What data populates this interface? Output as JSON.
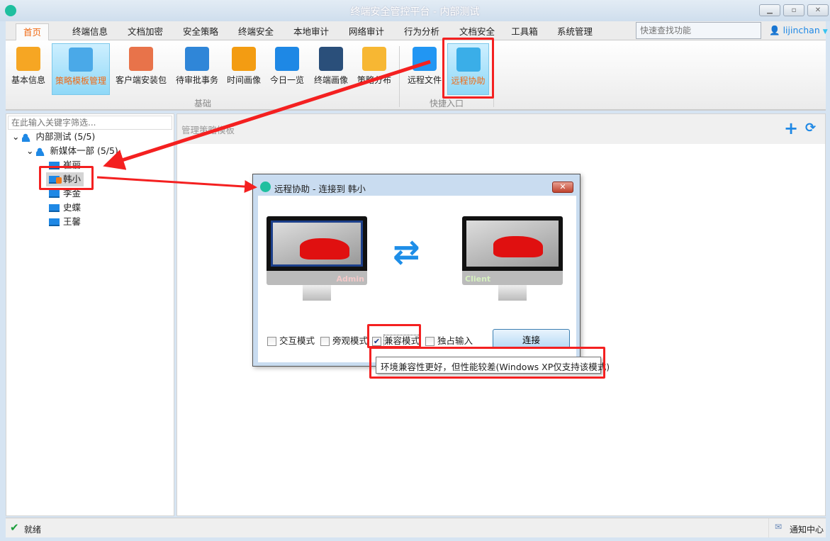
{
  "app": {
    "title": "终端安全管控平台 - 内部测试",
    "window_buttons": [
      "minimize",
      "maximize",
      "close"
    ]
  },
  "tabs": [
    {
      "label": "首页",
      "active": true
    },
    {
      "label": "终端信息"
    },
    {
      "label": "文档加密"
    },
    {
      "label": "安全策略"
    },
    {
      "label": "终端安全"
    },
    {
      "label": "本地审计"
    },
    {
      "label": "网络审计"
    },
    {
      "label": "行为分析"
    },
    {
      "label": "文档安全"
    },
    {
      "label": "工具箱"
    },
    {
      "label": "系统管理"
    }
  ],
  "search": {
    "placeholder": "快速查找功能"
  },
  "user": {
    "name": "lijinchan"
  },
  "ribbon": {
    "groups": [
      {
        "label": "基础"
      },
      {
        "label": "快捷入口"
      }
    ],
    "items": [
      {
        "label": "基本信息",
        "icon": "person-icon"
      },
      {
        "label": "策略模板管理",
        "icon": "clipboard-icon",
        "selected": true
      },
      {
        "label": "客户端安装包",
        "icon": "package-icon"
      },
      {
        "label": "待审批事务",
        "icon": "approval-icon"
      },
      {
        "label": "时间画像",
        "icon": "clock-icon"
      },
      {
        "label": "今日一览",
        "icon": "eye-icon"
      },
      {
        "label": "终端画像",
        "icon": "presenter-icon"
      },
      {
        "label": "策略分布",
        "icon": "chart-icon"
      },
      {
        "label": "远程文件",
        "icon": "folder-icon"
      },
      {
        "label": "远程协助",
        "icon": "monitor-search-icon",
        "selected": true
      }
    ]
  },
  "tree": {
    "filter_placeholder": "在此输入关键字筛选...",
    "root": "内部测试 (5/5)",
    "dept": "新媒体一部 (5/5)",
    "members": [
      "崔丽",
      "韩小",
      "李金",
      "史蝶",
      "王馨"
    ],
    "selected": "韩小"
  },
  "main": {
    "title": "管理策略模板"
  },
  "dialog": {
    "title": "远程协助 - 连接到 韩小",
    "admin_label": "Admin",
    "client_label": "Client",
    "options": [
      {
        "label": "交互模式",
        "checked": false
      },
      {
        "label": "旁观模式",
        "checked": false
      },
      {
        "label": "兼容模式",
        "checked": true
      },
      {
        "label": "独占输入",
        "checked": false
      }
    ],
    "connect": "连接",
    "tooltip": "环境兼容性更好，但性能较差(Windows XP仅支持该模式)"
  },
  "status": {
    "text": "就绪",
    "notify": "通知中心"
  },
  "colors": {
    "accent": "#f06a14",
    "blue": "#1e88e5",
    "annotation": "#f42020"
  }
}
